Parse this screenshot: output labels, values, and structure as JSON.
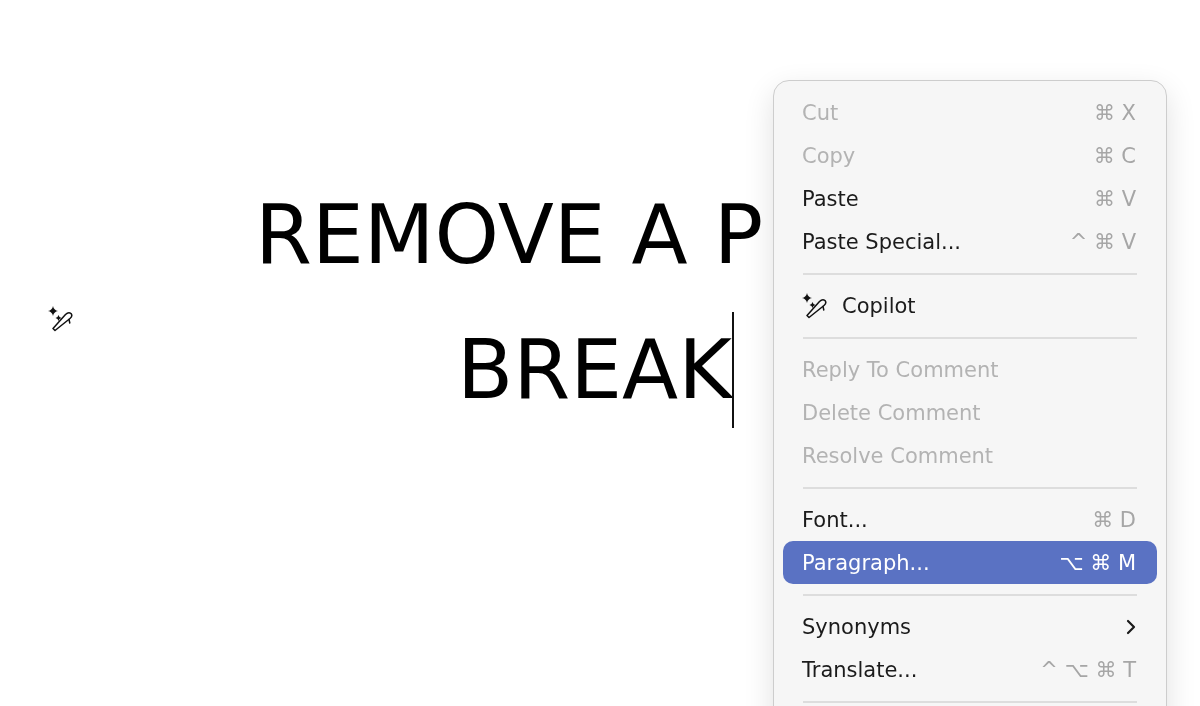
{
  "document": {
    "heading_lines": [
      "REMOVE A P",
      "BREAK"
    ]
  },
  "context_menu": {
    "items": [
      {
        "kind": "item",
        "label": "Cut",
        "shortcut": "⌘ X",
        "disabled": true,
        "selected": false
      },
      {
        "kind": "item",
        "label": "Copy",
        "shortcut": "⌘ C",
        "disabled": true,
        "selected": false
      },
      {
        "kind": "item",
        "label": "Paste",
        "shortcut": "⌘ V",
        "disabled": false,
        "selected": false
      },
      {
        "kind": "item",
        "label": "Paste Special...",
        "shortcut": "^ ⌘ V",
        "disabled": false,
        "selected": false
      },
      {
        "kind": "separator"
      },
      {
        "kind": "assistant",
        "label": "Copilot",
        "disabled": false,
        "selected": false
      },
      {
        "kind": "separator"
      },
      {
        "kind": "item",
        "label": "Reply To Comment",
        "disabled": true,
        "selected": false
      },
      {
        "kind": "item",
        "label": "Delete Comment",
        "disabled": true,
        "selected": false
      },
      {
        "kind": "item",
        "label": "Resolve Comment",
        "disabled": true,
        "selected": false
      },
      {
        "kind": "separator"
      },
      {
        "kind": "item",
        "label": "Font...",
        "shortcut": "⌘ D",
        "disabled": false,
        "selected": false
      },
      {
        "kind": "item",
        "label": "Paragraph...",
        "shortcut": "⌥ ⌘ M",
        "disabled": false,
        "selected": true
      },
      {
        "kind": "separator"
      },
      {
        "kind": "submenu",
        "label": "Synonyms",
        "disabled": false,
        "selected": false
      },
      {
        "kind": "item",
        "label": "Translate...",
        "shortcut": "^ ⌥ ⌘ T",
        "disabled": false,
        "selected": false
      },
      {
        "kind": "separator"
      }
    ]
  }
}
